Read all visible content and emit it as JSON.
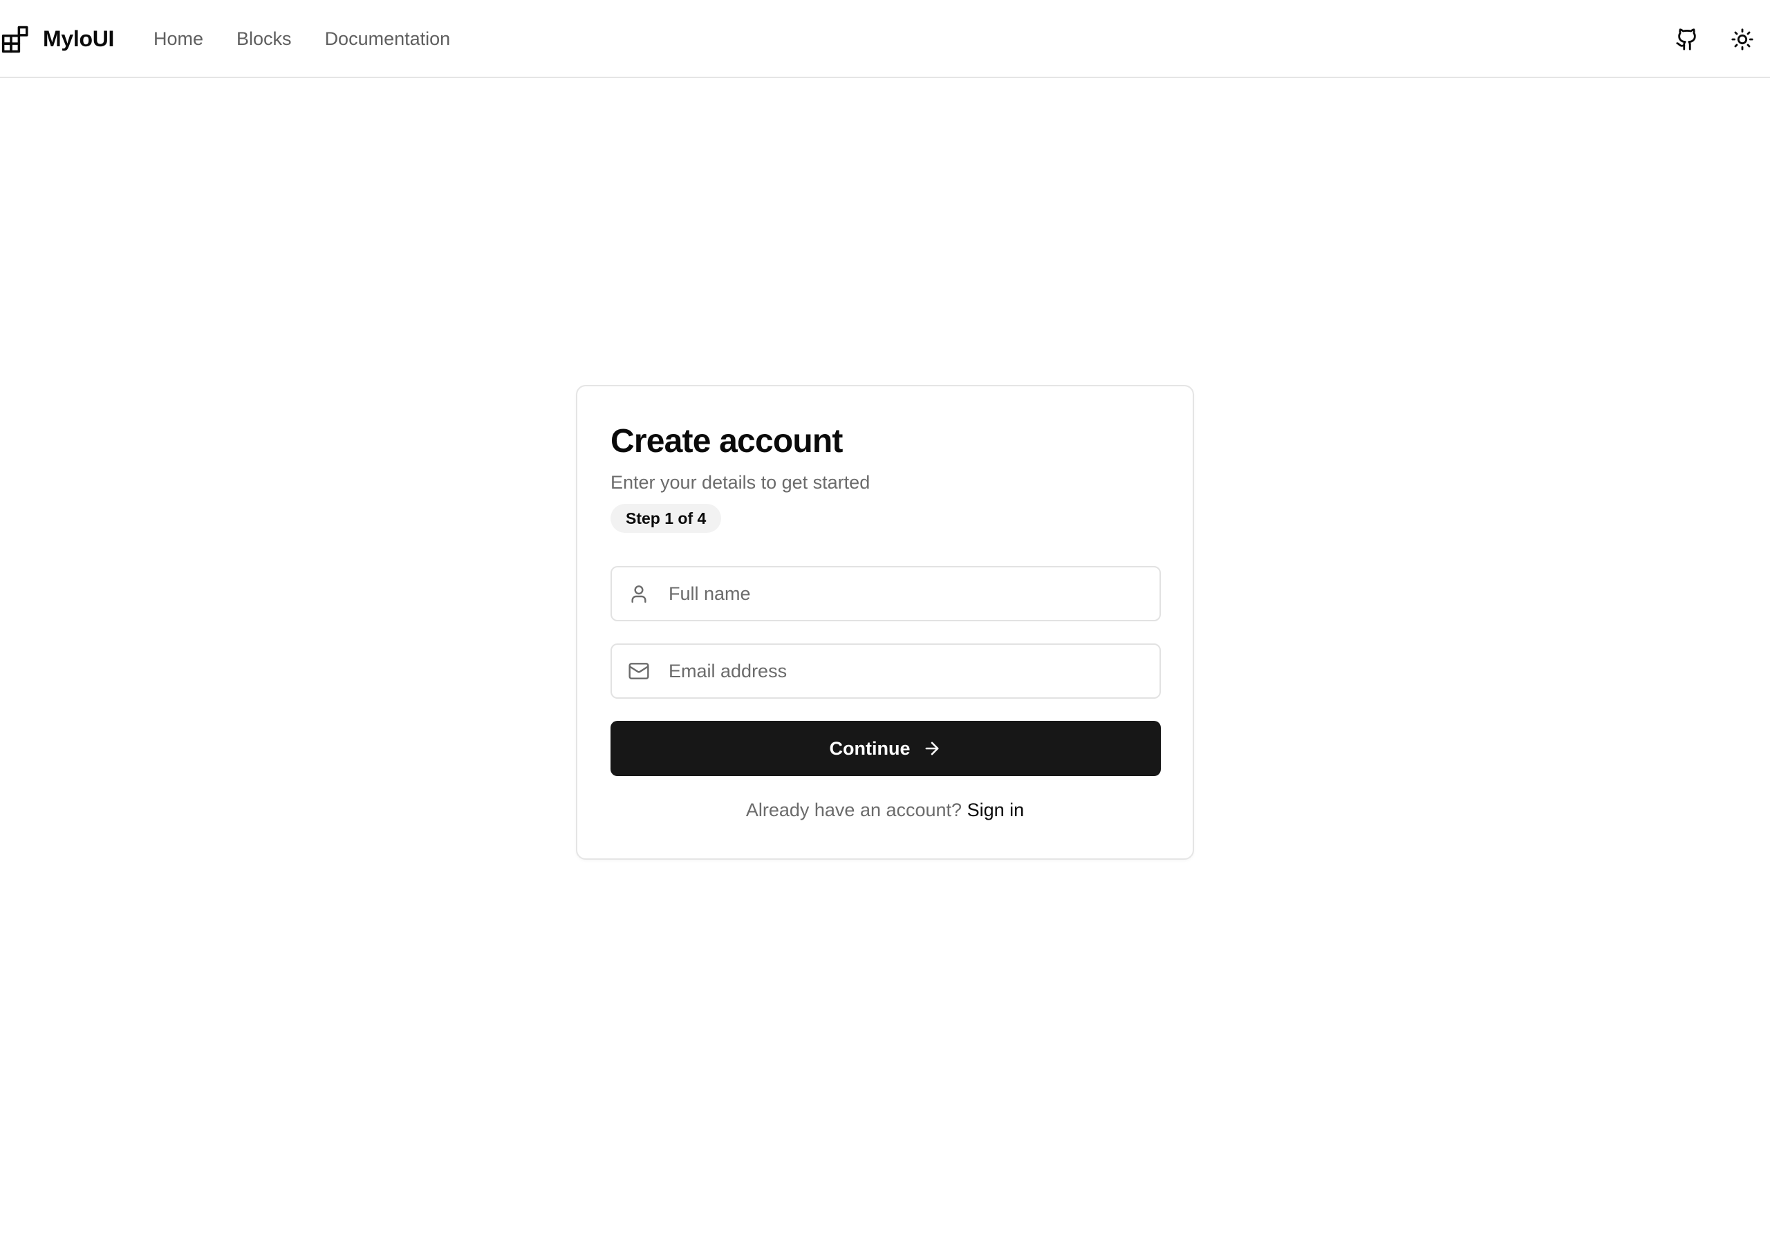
{
  "header": {
    "brand_name": "MyloUI",
    "brand_icon": "blocks-icon",
    "nav": [
      {
        "label": "Home"
      },
      {
        "label": "Blocks"
      },
      {
        "label": "Documentation"
      }
    ],
    "actions": [
      {
        "icon": "github-icon"
      },
      {
        "icon": "sun-icon"
      }
    ]
  },
  "card": {
    "title": "Create account",
    "subtitle": "Enter your details to get started",
    "step_badge": "Step 1 of 4",
    "fields": {
      "full_name": {
        "placeholder": "Full name",
        "value": "",
        "icon": "user-icon"
      },
      "email": {
        "placeholder": "Email address",
        "value": "",
        "icon": "mail-icon"
      }
    },
    "continue_label": "Continue",
    "continue_icon": "arrow-right-icon",
    "signin_prompt": "Already have an account?",
    "signin_link": "Sign in"
  },
  "colors": {
    "primary_button": "#171717",
    "border": "#e5e5e5",
    "muted_text": "#6b6b6b",
    "badge_bg": "#f2f2f2"
  }
}
